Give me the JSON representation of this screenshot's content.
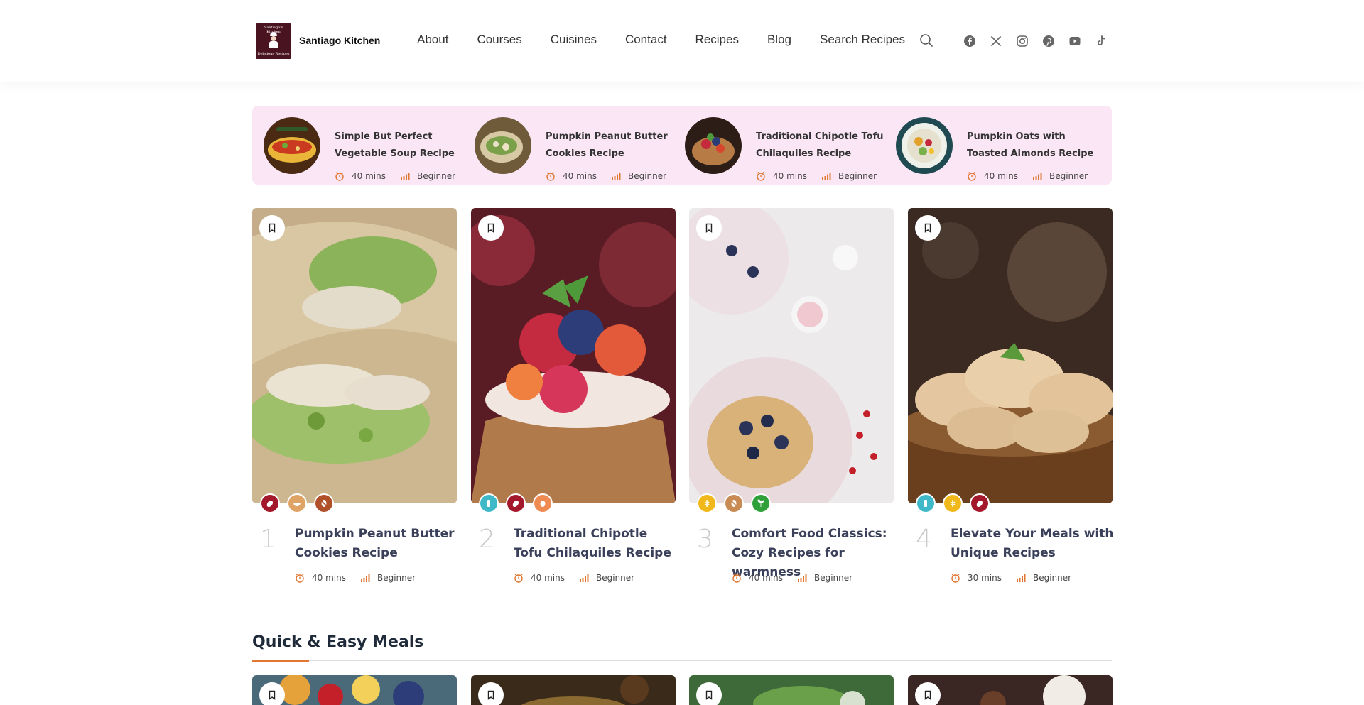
{
  "brand": {
    "name": "Santiago Kitchen",
    "logo_line1": "Santiago's Kitchen",
    "logo_line2": "Delicious Recipes"
  },
  "nav": {
    "items": [
      "About",
      "Courses",
      "Cuisines",
      "Contact",
      "Recipes",
      "Blog",
      "Search Recipes"
    ]
  },
  "icons": {
    "search": "search-icon",
    "socials": [
      "facebook-icon",
      "x-twitter-icon",
      "instagram-icon",
      "pinterest-icon",
      "youtube-icon",
      "tiktok-icon"
    ],
    "time": "alarm-clock-icon",
    "difficulty": "signal-bars-icon",
    "bookmark": "bookmark-icon"
  },
  "colors": {
    "strip_bg": "#fbe6f6",
    "accent_orange": "#e0762f",
    "title_text": "#3a3f5a"
  },
  "featured_strip": [
    {
      "title": "Simple But Perfect Vegetable Soup Recipe",
      "time": "40 mins",
      "level": "Beginner"
    },
    {
      "title": "Pumpkin Peanut Butter Cookies Recipe",
      "time": "40 mins",
      "level": "Beginner"
    },
    {
      "title": "Traditional Chipotle Tofu Chilaquiles Recipe",
      "time": "40 mins",
      "level": "Beginner"
    },
    {
      "title": "Pumpkin Oats with Toasted Almonds Recipe",
      "time": "40 mins",
      "level": "Beginner"
    }
  ],
  "cards": [
    {
      "num": "1",
      "title": "Pumpkin Peanut Butter Cookies Recipe",
      "time": "40 mins",
      "level": "Beginner",
      "badges": [
        "meat-icon",
        "bowl-icon",
        "nut-free-icon"
      ]
    },
    {
      "num": "2",
      "title": "Traditional Chipotle Tofu Chilaquiles Recipe",
      "time": "40 mins",
      "level": "Beginner",
      "badges": [
        "dairy-free-icon",
        "meat-icon",
        "egg-free-icon"
      ]
    },
    {
      "num": "3",
      "title": "Comfort Food Classics: Cozy Recipes for warmness",
      "time": "40 mins",
      "level": "Beginner",
      "badges": [
        "gluten-free-icon",
        "nut-free-icon",
        "vegan-icon"
      ]
    },
    {
      "num": "4",
      "title": "Elevate Your Meals with Unique Recipes",
      "time": "30 mins",
      "level": "Beginner",
      "badges": [
        "dairy-free-icon",
        "wheat-icon",
        "meat-icon"
      ]
    }
  ],
  "section": {
    "title": "Quick & Easy Meals"
  }
}
